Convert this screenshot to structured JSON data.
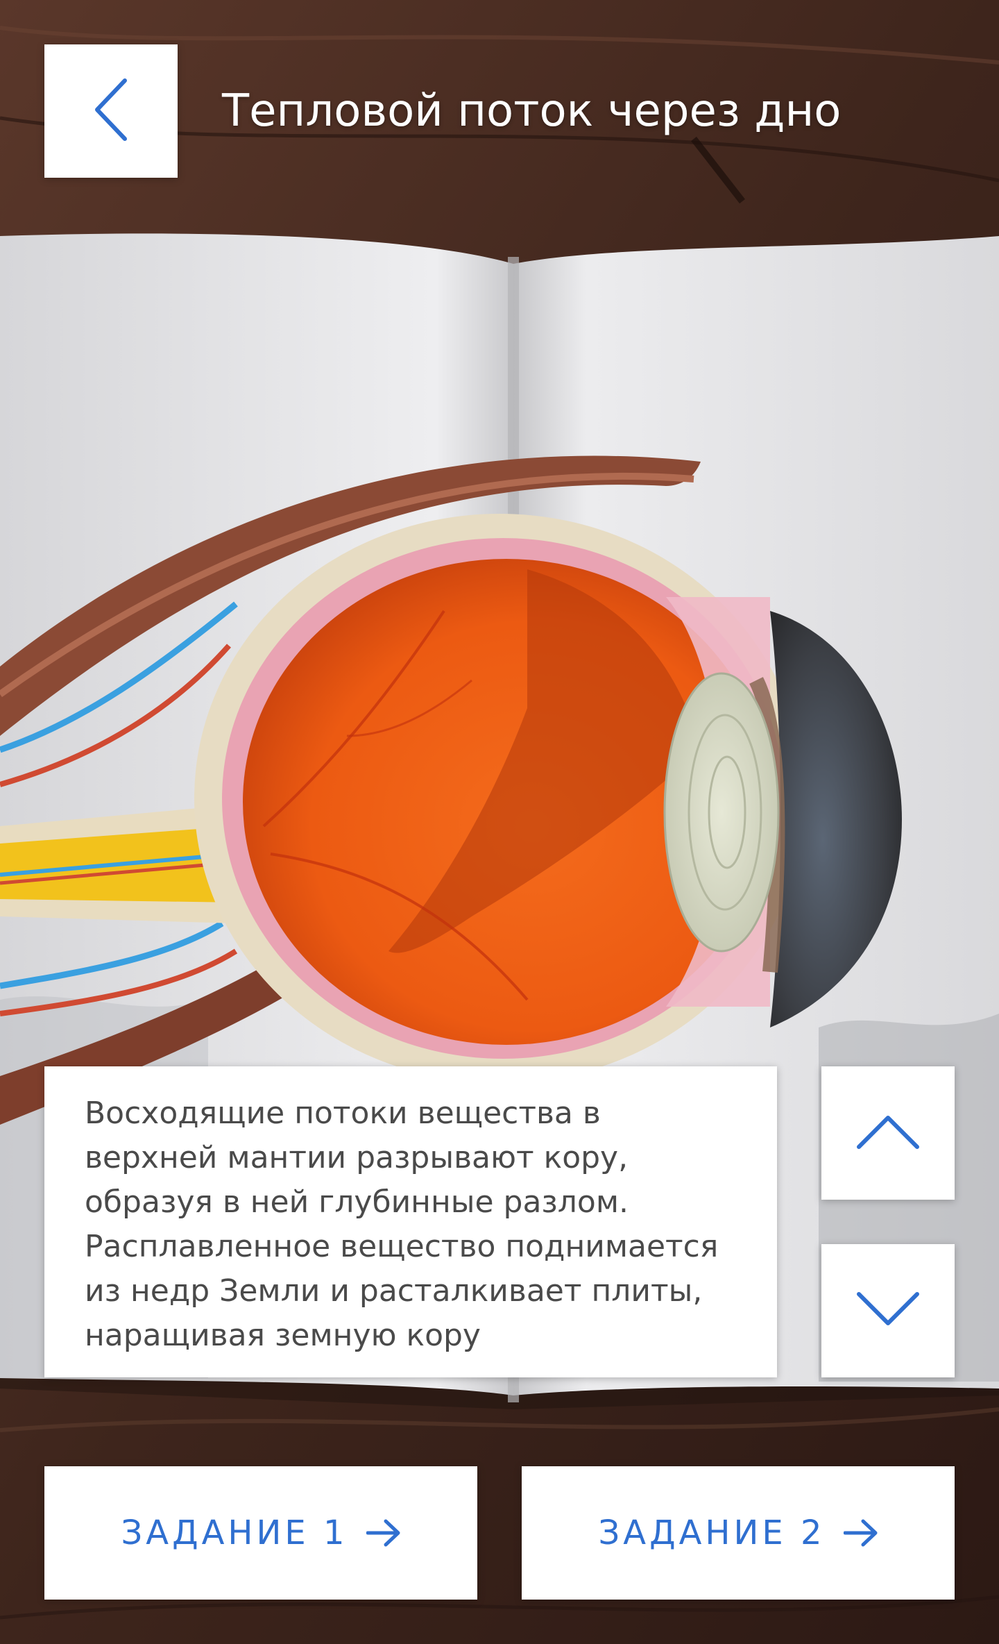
{
  "header": {
    "title": "Тепловой поток через дно"
  },
  "info": {
    "text": "Восходящие потоки вещества в верхней мантии разрывают кору, образуя в ней глубинные разлом. Расплавленное вещество поднимается из недр Земли и расталкивает плиты, наращивая земную кору"
  },
  "tasks": [
    {
      "label": "ЗАДАНИЕ 1"
    },
    {
      "label": "ЗАДАНИЕ 2"
    }
  ],
  "icons": {
    "back": "chevron-left-icon",
    "up": "chevron-up-icon",
    "down": "chevron-down-icon",
    "task_arrow": "arrow-right-icon"
  },
  "colors": {
    "accent": "#2f6fd0",
    "panel": "#ffffff",
    "text": "#4a4a4a",
    "background": "#3b231b"
  }
}
